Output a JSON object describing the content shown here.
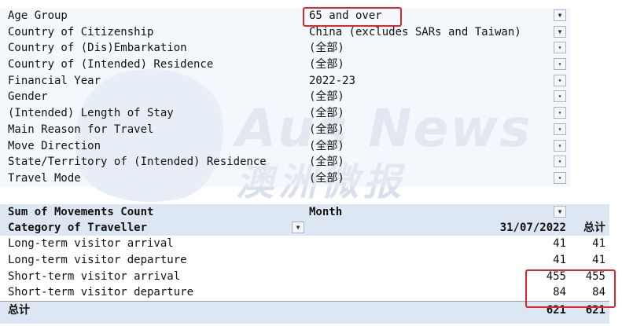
{
  "filters": [
    {
      "label": "Age Group",
      "value": "65 and over",
      "icon": "filter-funnel-icon"
    },
    {
      "label": "Country of Citizenship",
      "value": "China (excludes SARs and Taiwan)",
      "icon": "filter-funnel-icon"
    },
    {
      "label": "Country of (Dis)Embarkation",
      "value": "(全部)",
      "icon": "dropdown-arrow-icon"
    },
    {
      "label": "Country of (Intended) Residence",
      "value": "(全部)",
      "icon": "dropdown-arrow-icon"
    },
    {
      "label": "Financial Year",
      "value": "2022-23",
      "icon": "dropdown-arrow-icon"
    },
    {
      "label": "Gender",
      "value": "(全部)",
      "icon": "dropdown-arrow-icon"
    },
    {
      "label": "(Intended) Length of Stay",
      "value": "(全部)",
      "icon": "dropdown-arrow-icon"
    },
    {
      "label": "Main Reason for Travel",
      "value": "(全部)",
      "icon": "dropdown-arrow-icon"
    },
    {
      "label": "Move Direction",
      "value": "(全部)",
      "icon": "dropdown-arrow-icon"
    },
    {
      "label": "State/Territory of (Intended) Residence",
      "value": "(全部)",
      "icon": "dropdown-arrow-icon"
    },
    {
      "label": "Travel Mode",
      "value": "(全部)",
      "icon": "dropdown-arrow-icon"
    }
  ],
  "pivot": {
    "measure_label": "Sum of Movements Count",
    "column_field": "Month",
    "row_field": "Category of Traveller",
    "column_header": "31/07/2022",
    "grand_total_label": "总计",
    "rows": [
      {
        "category": "Long-term visitor arrival",
        "value": "41",
        "total": "41"
      },
      {
        "category": "Long-term visitor departure",
        "value": "41",
        "total": "41"
      },
      {
        "category": "Short-term visitor arrival",
        "value": "455",
        "total": "455"
      },
      {
        "category": "Short-term visitor departure",
        "value": "84",
        "total": "84"
      }
    ],
    "grand_total": {
      "label": "总计",
      "value": "621",
      "total": "621"
    }
  },
  "watermark": {
    "text": "Aus News",
    "cn": "澳洲微报"
  },
  "highlight_color": "#e0262a"
}
